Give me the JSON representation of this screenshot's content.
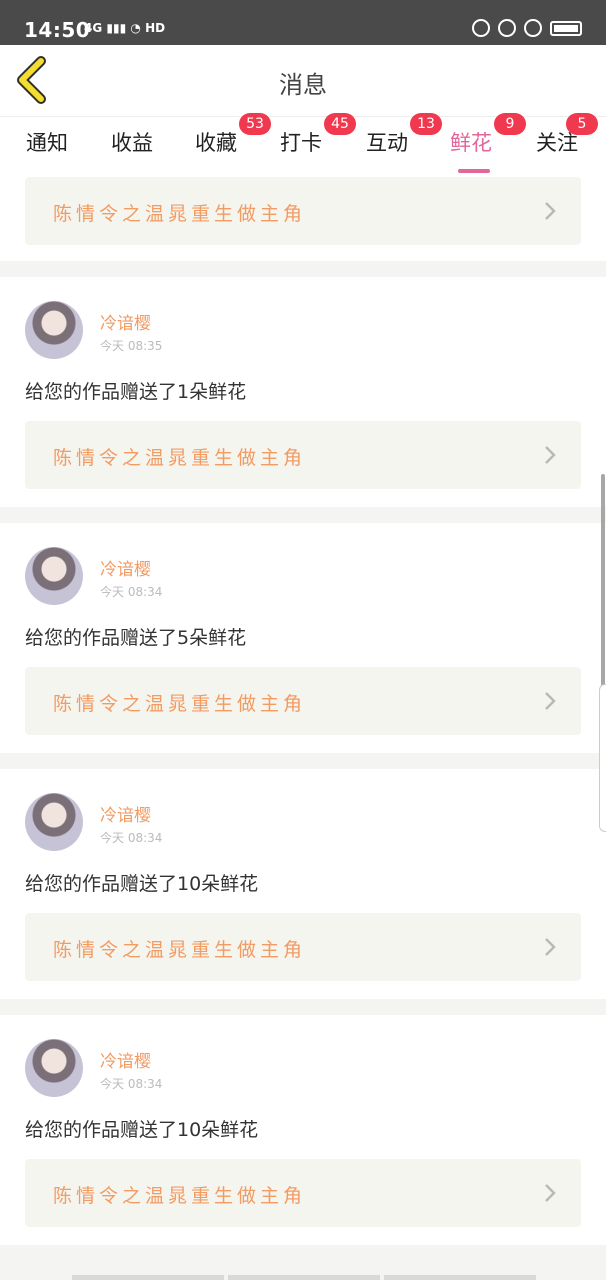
{
  "status_bar": {
    "time": "14:50",
    "network": "4G",
    "hd": "HD"
  },
  "header": {
    "title": "消息"
  },
  "tabs": [
    {
      "label": "通知",
      "badge": ""
    },
    {
      "label": "收益",
      "badge": ""
    },
    {
      "label": "收藏",
      "badge": "53"
    },
    {
      "label": "打卡",
      "badge": "45"
    },
    {
      "label": "互动",
      "badge": "13"
    },
    {
      "label": "鲜花",
      "badge": "9",
      "active": true
    },
    {
      "label": "关注",
      "badge": "5"
    }
  ],
  "messages": [
    {
      "work_title": "陈情令之温晁重生做主角"
    },
    {
      "user": "冷谙樱",
      "time": "今天 08:35",
      "text": "给您的作品赠送了1朵鲜花",
      "work_title": "陈情令之温晁重生做主角"
    },
    {
      "user": "冷谙樱",
      "time": "今天 08:34",
      "text": "给您的作品赠送了5朵鲜花",
      "work_title": "陈情令之温晁重生做主角"
    },
    {
      "user": "冷谙樱",
      "time": "今天 08:34",
      "text": "给您的作品赠送了10朵鲜花",
      "work_title": "陈情令之温晁重生做主角"
    },
    {
      "user": "冷谙樱",
      "time": "今天 08:34",
      "text": "给您的作品赠送了10朵鲜花",
      "work_title": "陈情令之温晁重生做主角"
    }
  ],
  "colors": {
    "accent": "#e0679a",
    "badge": "#f0394f",
    "link_text": "#f29b63",
    "back_arrow": "#f3dd2f"
  },
  "icons": {
    "back": "chevron-left-icon",
    "link": "chevron-right-icon"
  }
}
